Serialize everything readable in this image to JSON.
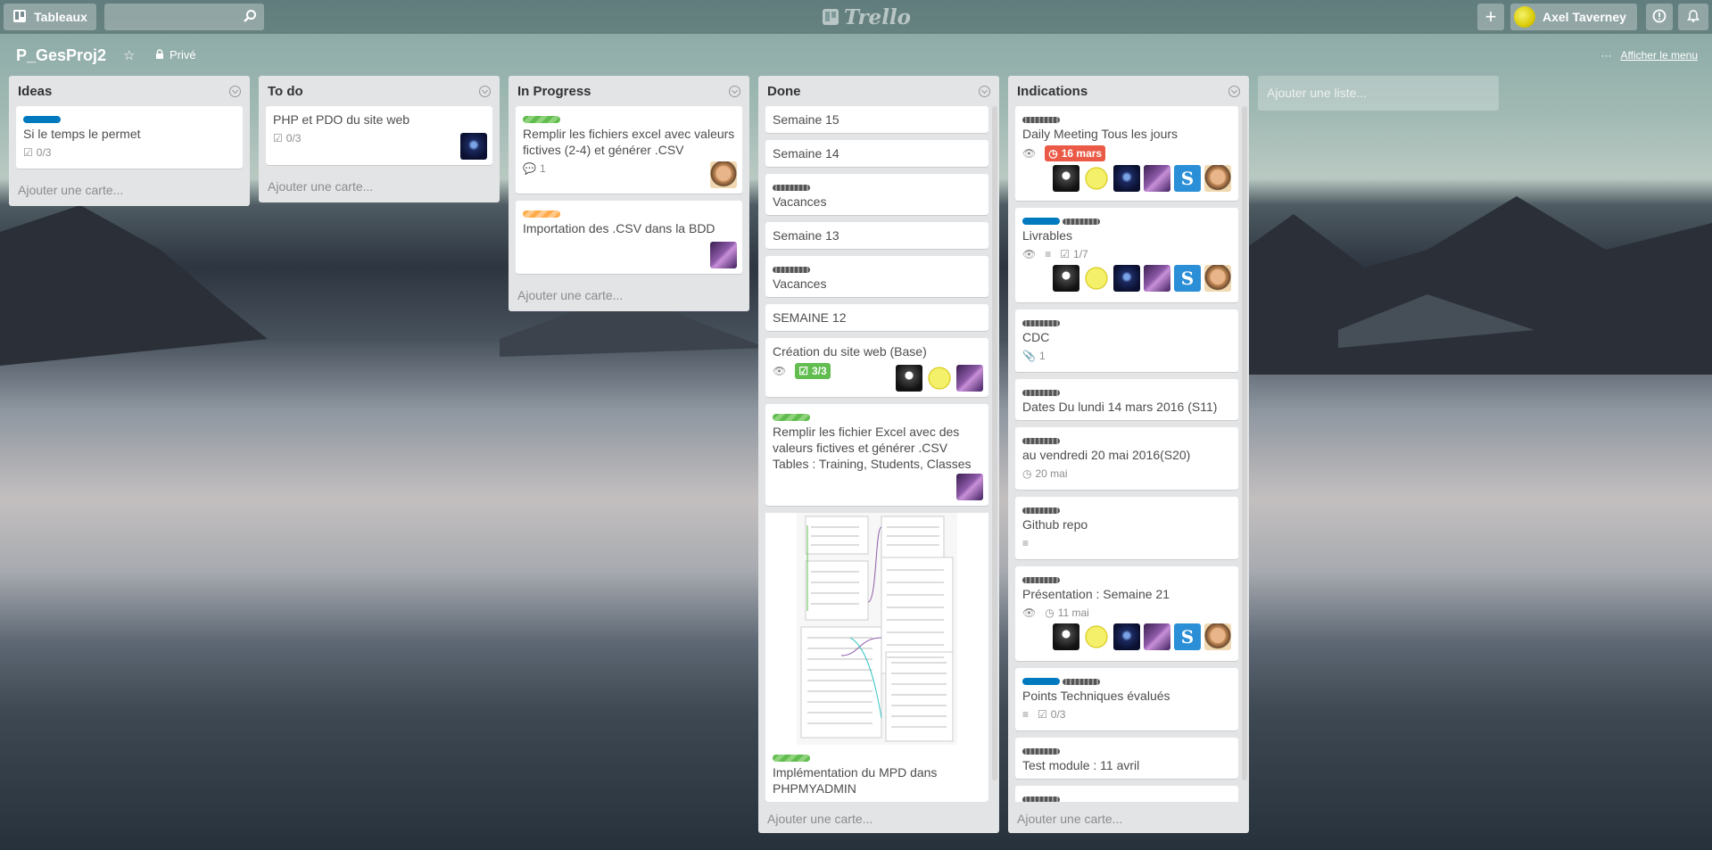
{
  "header": {
    "boards_label": "Tableaux",
    "search_placeholder": "",
    "logo_text": "Trello",
    "user_name": "Axel Taverney"
  },
  "board": {
    "name": "P_GesProj2",
    "visibility": "Privé",
    "menu_link": "Afficher le menu"
  },
  "add_list_label": "Ajouter une liste...",
  "add_card_label": "Ajouter une carte...",
  "lists": {
    "ideas": {
      "title": "Ideas",
      "cards": [
        {
          "title": "Si le temps le permet",
          "checklist": "0/3"
        }
      ]
    },
    "todo": {
      "title": "To do",
      "cards": [
        {
          "title": "PHP et PDO du site web",
          "checklist": "0/3"
        }
      ]
    },
    "progress": {
      "title": "In Progress",
      "cards": [
        {
          "title": "Remplir les fichiers excel avec valeurs fictives (2-4) et générer .CSV",
          "comments": "1"
        },
        {
          "title": "Importation des .CSV dans la BDD"
        }
      ]
    },
    "done": {
      "title": "Done",
      "cards": [
        {
          "title": "Semaine 15"
        },
        {
          "title": "Semaine 14"
        },
        {
          "title": "Vacances"
        },
        {
          "title": "Semaine 13"
        },
        {
          "title": "Vacances"
        },
        {
          "title": "SEMAINE 12"
        },
        {
          "title": "Création du site web (Base)",
          "checklist": "3/3"
        },
        {
          "title": "Remplir les fichier Excel avec des valeurs fictives et générer .CSV Tables : Training, Students, Classes"
        },
        {
          "title": "Implémentation du MPD dans PHPMYADMIN"
        }
      ]
    },
    "indications": {
      "title": "Indications",
      "cards": [
        {
          "title": "Daily Meeting Tous les jours",
          "due": "16 mars"
        },
        {
          "title": "Livrables",
          "checklist": "1/7"
        },
        {
          "title": "CDC",
          "attachments": "1"
        },
        {
          "title": "Dates Du lundi 14 mars 2016 (S11)"
        },
        {
          "title": "au vendredi 20 mai 2016(S20)",
          "due": "20 mai"
        },
        {
          "title": "Github repo"
        },
        {
          "title": "Présentation : Semaine 21",
          "due": "11 mai"
        },
        {
          "title": "Points Techniques évalués",
          "checklist": "0/3"
        },
        {
          "title": "Test module : 11 avril"
        }
      ]
    }
  },
  "colors": {
    "list_bg": "#e2e4e6",
    "label_blue": "#0079bf",
    "label_green": "#61bd4f",
    "label_orange": "#ffab4a",
    "due_red": "#eb5a46"
  }
}
